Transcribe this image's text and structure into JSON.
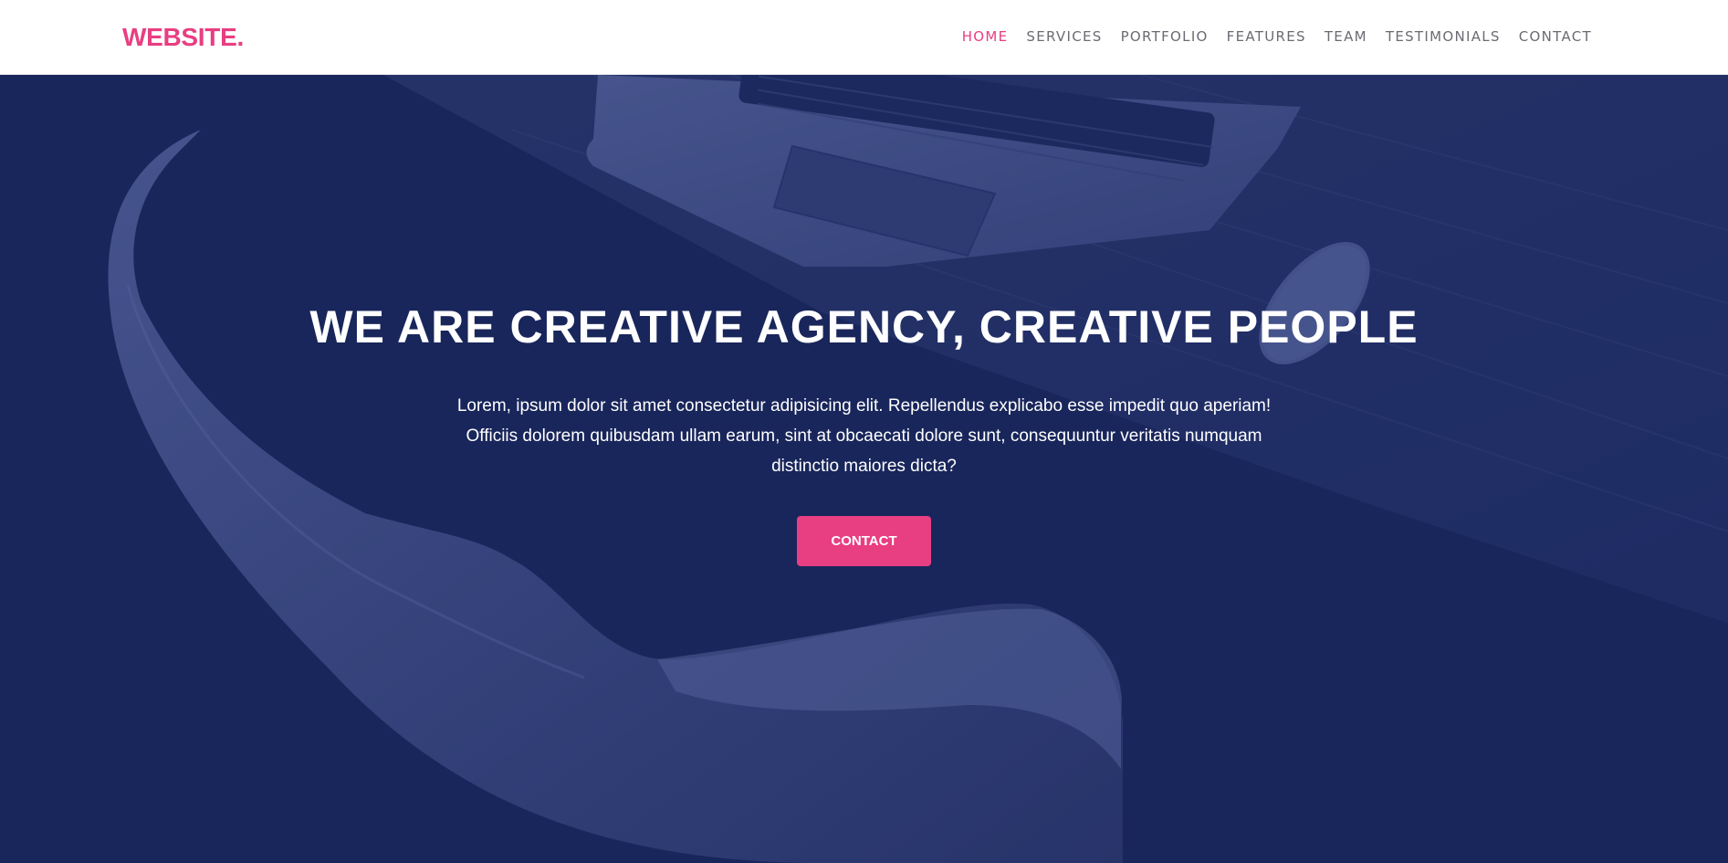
{
  "brand": {
    "logo": "WEBSITE.",
    "accent_color": "#e83e82",
    "overlay_color": "#18265a"
  },
  "nav": {
    "items": [
      {
        "label": "HOME",
        "active": true
      },
      {
        "label": "SERVICES",
        "active": false
      },
      {
        "label": "PORTFOLIO",
        "active": false
      },
      {
        "label": "FEATURES",
        "active": false
      },
      {
        "label": "TEAM",
        "active": false
      },
      {
        "label": "TESTIMONIALS",
        "active": false
      },
      {
        "label": "CONTACT",
        "active": false
      }
    ]
  },
  "hero": {
    "title": "WE ARE CREATIVE AGENCY, CREATIVE PEOPLE",
    "text": "Lorem, ipsum dolor sit amet consectetur adipisicing elit. Repellendus explicabo esse impedit quo aperiam! Officiis dolorem quibusdam ullam earum, sint at obcaecati dolore sunt, consequuntur veritatis numquam distinctio maiores dicta?",
    "button_label": "CONTACT"
  }
}
